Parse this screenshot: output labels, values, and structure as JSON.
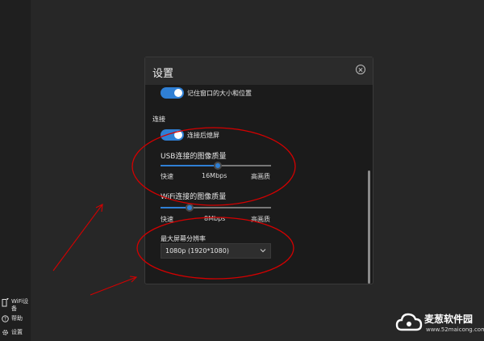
{
  "sidebar": {
    "wifi_label": "WiFi设备",
    "help_label": "帮助",
    "settings_label": "设置"
  },
  "dialog": {
    "title": "设置",
    "remember_window": "记住窗口的大小和位置",
    "connection_section": "连接",
    "blank_after_connect": "连接后熄屏",
    "usb_quality": {
      "title": "USB连接的图像质量",
      "min_label": "快速",
      "value_label": "16Mbps",
      "max_label": "高画质",
      "level": 0.52
    },
    "wifi_quality": {
      "title": "WiFi连接的图像质量",
      "min_label": "快速",
      "value_label": "8Mbps",
      "max_label": "高画质",
      "level": 0.26
    },
    "max_resolution": {
      "label": "最大屏幕分辨率",
      "value": "1080p (1920*1080)"
    }
  },
  "watermark": {
    "name": "麦葱软件园",
    "url": "www.52maicong.com"
  },
  "colors": {
    "accent": "#2f7fd4",
    "annotation": "#d40000"
  }
}
